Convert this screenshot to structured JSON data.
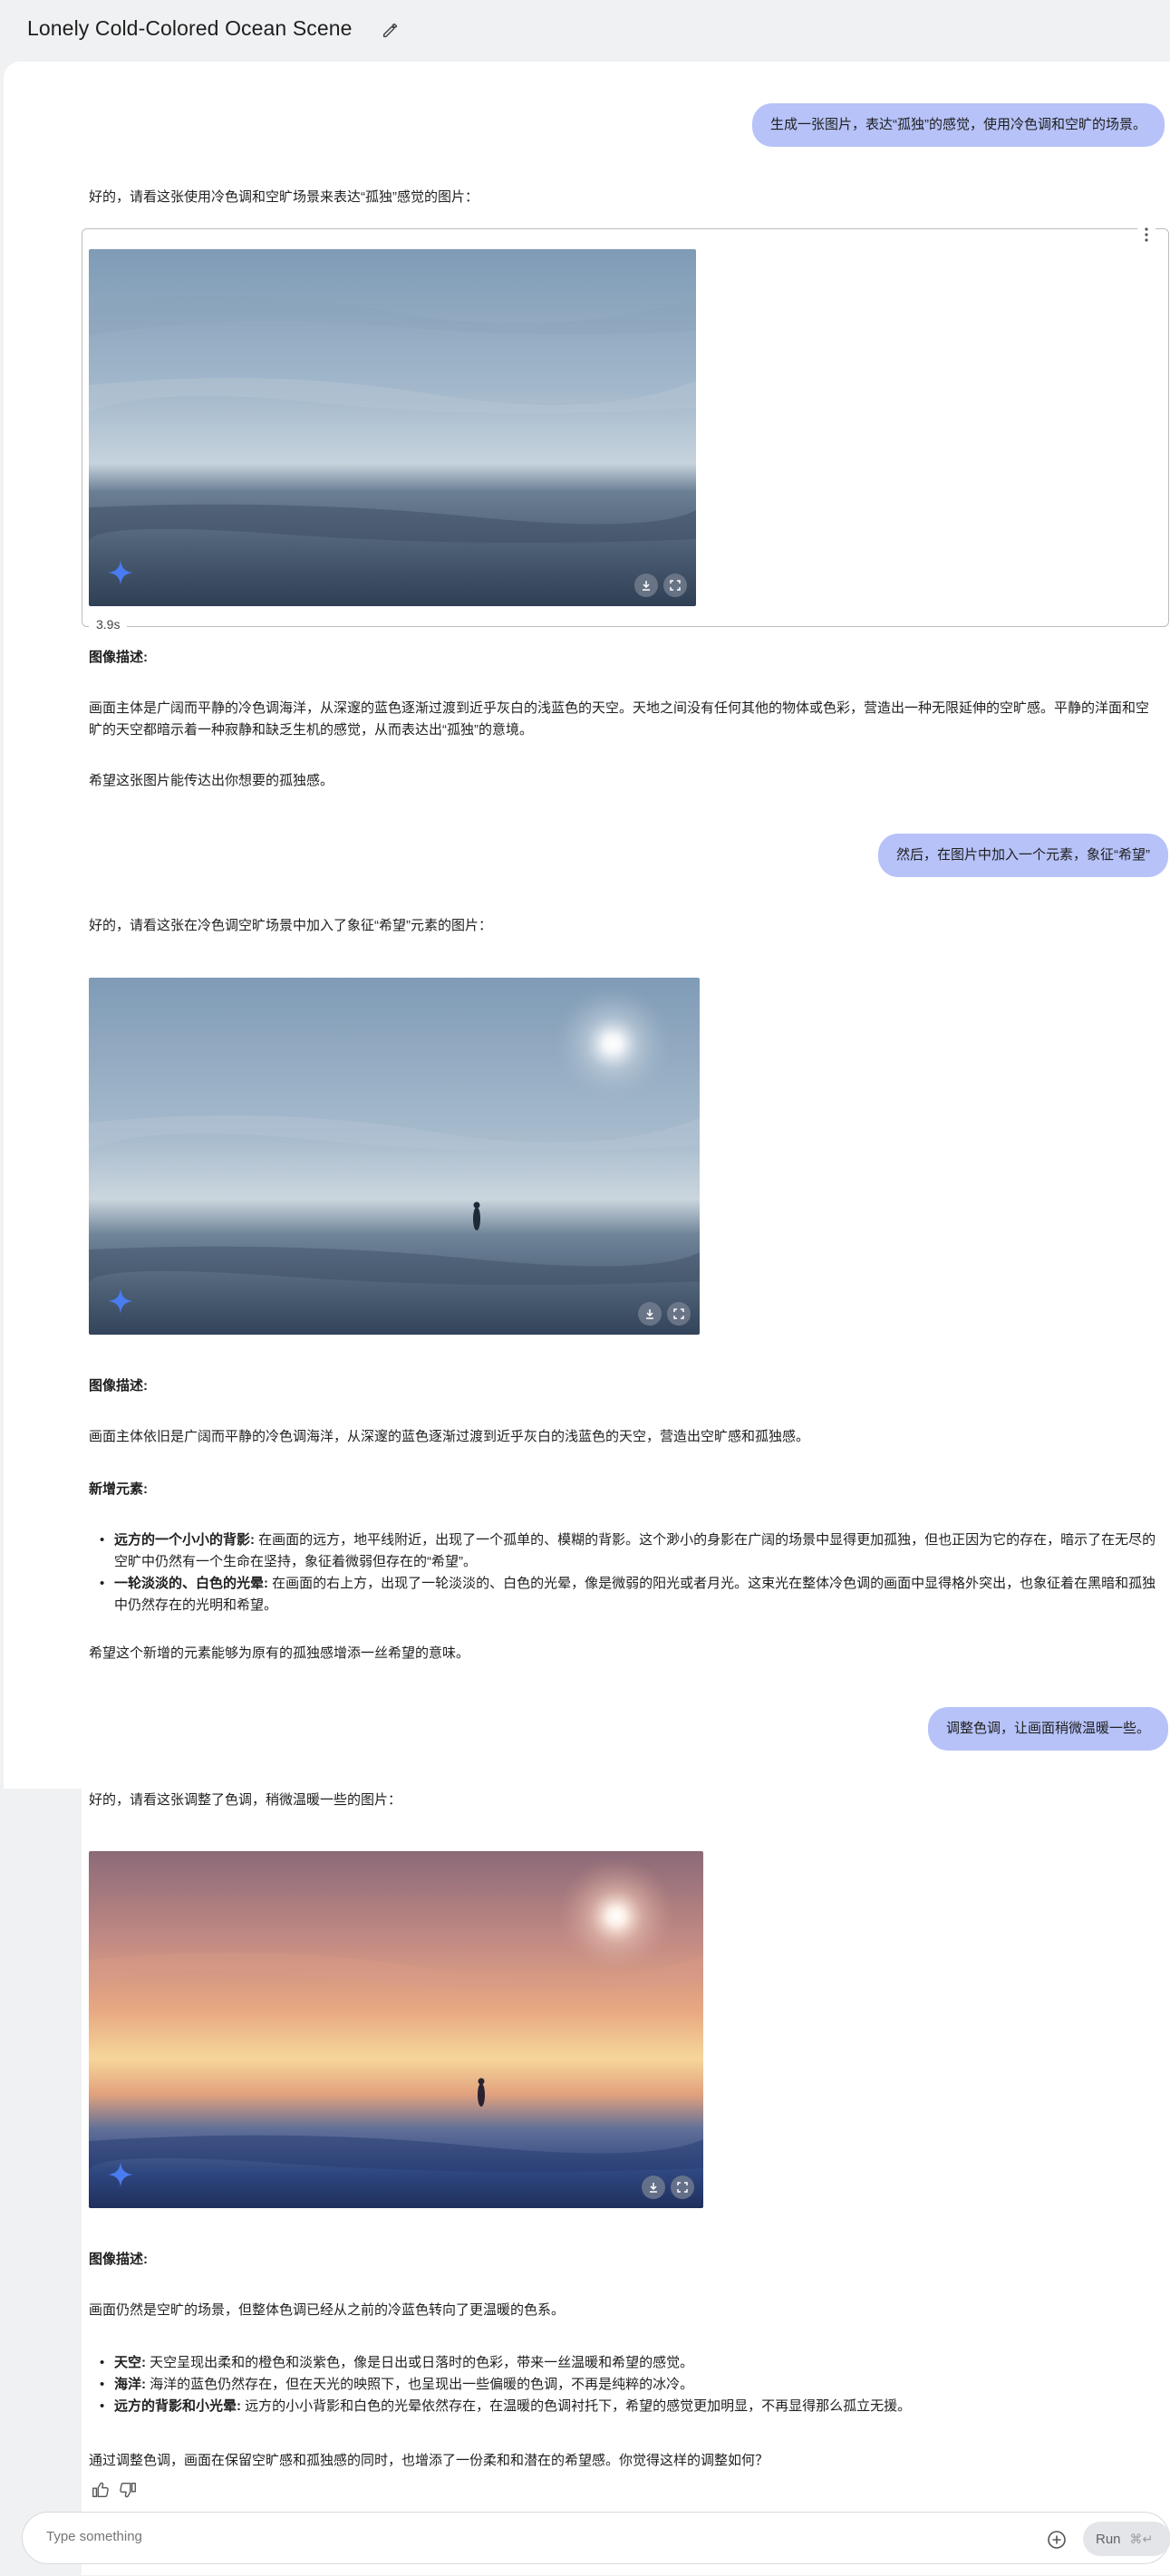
{
  "header": {
    "title": "Lonely Cold-Colored Ocean Scene"
  },
  "turns": {
    "user1": "生成一张图片，表达“孤独”的感觉，使用冷色调和空旷的场景。",
    "reply1_intro": "好的，请看这张使用冷色调和空旷场景来表达“孤独”感觉的图片：",
    "duration": "3.9s",
    "reply1_heading": "图像描述:",
    "reply1_desc": "画面主体是广阔而平静的冷色调海洋，从深邃的蓝色逐渐过渡到近乎灰白的浅蓝色的天空。天地之间没有任何其他的物体或色彩，营造出一种无限延伸的空旷感。平静的洋面和空旷的天空都暗示着一种寂静和缺乏生机的感觉，从而表达出“孤独”的意境。",
    "reply1_closing": "希望这张图片能传达出你想要的孤独感。",
    "user2": "然后，在图片中加入一个元素，象征“希望”",
    "reply2_intro": "好的，请看这张在冷色调空旷场景中加入了象征“希望”元素的图片：",
    "reply2_heading": "图像描述:",
    "reply2_desc": "画面主体依旧是广阔而平静的冷色调海洋，从深邃的蓝色逐渐过渡到近乎灰白的浅蓝色的天空，营造出空旷感和孤独感。",
    "reply2_new_heading": "新增元素:",
    "reply2_bullets": [
      {
        "term": "远方的一个小小的背影:",
        "text": " 在画面的远方，地平线附近，出现了一个孤单的、模糊的背影。这个渺小的身影在广阔的场景中显得更加孤独，但也正因为它的存在，暗示了在无尽的空旷中仍然有一个生命在坚持，象征着微弱但存在的“希望”。"
      },
      {
        "term": "一轮淡淡的、白色的光晕:",
        "text": " 在画面的右上方，出现了一轮淡淡的、白色的光晕，像是微弱的阳光或者月光。这束光在整体冷色调的画面中显得格外突出，也象征着在黑暗和孤独中仍然存在的光明和希望。"
      }
    ],
    "reply2_closing": "希望这个新增的元素能够为原有的孤独感增添一丝希望的意味。",
    "user3": "调整色调，让画面稍微温暖一些。",
    "reply3_intro": "好的，请看这张调整了色调，稍微温暖一些的图片：",
    "reply3_heading": "图像描述:",
    "reply3_desc": "画面仍然是空旷的场景，但整体色调已经从之前的冷蓝色转向了更温暖的色系。",
    "reply3_bullets": [
      {
        "term": "天空:",
        "text": " 天空呈现出柔和的橙色和淡紫色，像是日出或日落时的色彩，带来一丝温暖和希望的感觉。"
      },
      {
        "term": "海洋:",
        "text": " 海洋的蓝色仍然存在，但在天光的映照下，也呈现出一些偏暖的色调，不再是纯粹的冰冷。"
      },
      {
        "term": "远方的背影和小光晕:",
        "text": " 远方的小小背影和白色的光晕依然存在，在温暖的色调衬托下，希望的感觉更加明显，不再显得那么孤立无援。"
      }
    ],
    "reply3_closing": "通过调整色调，画面在保留空旷感和孤独感的同时，也增添了一份柔和和潜在的希望感。你觉得这样的调整如何？"
  },
  "input": {
    "placeholder": "Type something",
    "run_label": "Run",
    "run_shortcut": "⌘↵"
  },
  "icons": [
    "edit-icon",
    "more-vert-icon",
    "sparkle-icon",
    "download-icon",
    "fullscreen-icon",
    "thumb-up-icon",
    "thumb-down-icon",
    "add-circle-icon"
  ],
  "colors": {
    "user_bubble": "#b6c2f8",
    "sparkle": "#4a7bf0",
    "background": "#f0f1f3"
  }
}
